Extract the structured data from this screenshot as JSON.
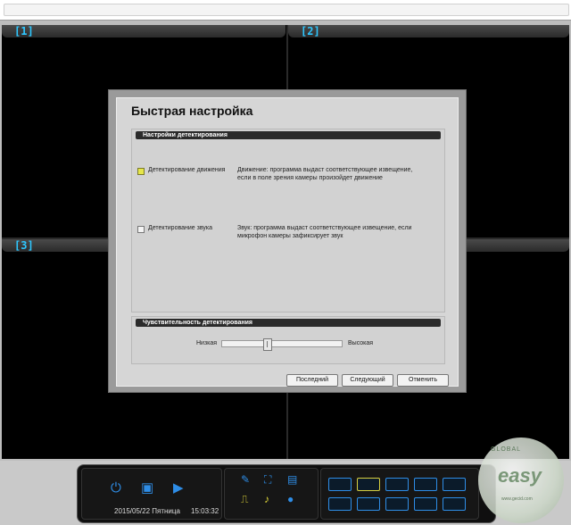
{
  "panes": {
    "p1": "[1]",
    "p2": "[2]",
    "p3": "[3]"
  },
  "dialog": {
    "title": "Быстрая настройка",
    "detection": {
      "section_title": "Настройки детектирования",
      "motion": {
        "label": "Детектирование движения",
        "checked": true,
        "description": "Движение: программа выдаст соответствующее извещение, если в поле зрения камеры произойдет движение"
      },
      "sound": {
        "label": "Детектирование звука",
        "checked": false,
        "description": "Звук: программа выдаст соответствующее извещение, если микрофон камеры зафиксирует звук"
      }
    },
    "sensitivity": {
      "section_title": "Чувствительность детектирования",
      "low_label": "Низкая",
      "high_label": "Высокая",
      "level_fraction": 0.37
    },
    "buttons": {
      "last": "Последний",
      "next": "Следующий",
      "cancel": "Отменить"
    }
  },
  "toolbar": {
    "date": "2015/05/22 Пятница",
    "time": "15:03:32",
    "icons": [
      "power-icon",
      "play-square-icon",
      "play-icon",
      "wrench-icon",
      "fullscreen-icon",
      "save-icon",
      "signal-icon",
      "speaker-icon",
      "chat-icon"
    ],
    "accent_color": "#2e8de6",
    "selected_layout_color": "#d8d040"
  },
  "watermark": {
    "arc_text": "GLOBAL",
    "text": "easy",
    "url": "www.gecid.com"
  }
}
